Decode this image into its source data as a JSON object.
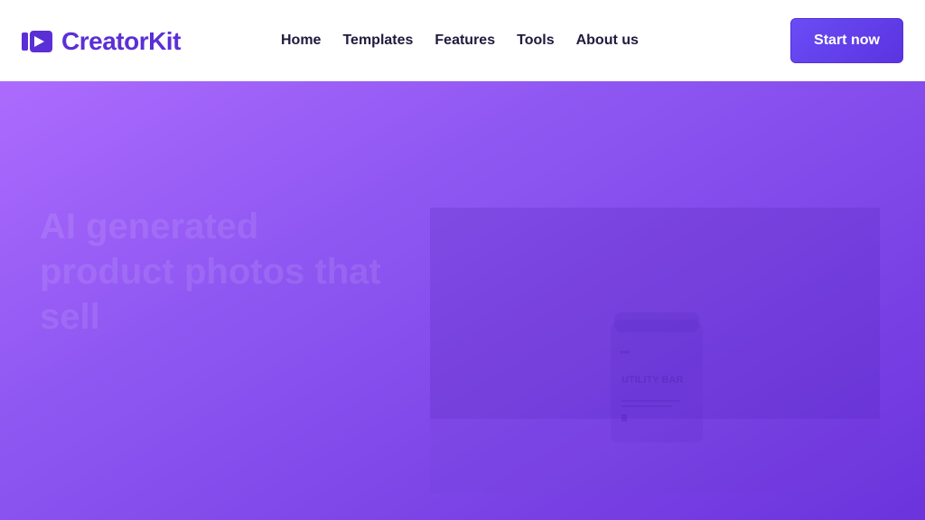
{
  "brand": {
    "name": "CreatorKit",
    "icon": "play-camera-icon",
    "color": "#5b2fd6"
  },
  "nav": {
    "items": [
      {
        "label": "Home"
      },
      {
        "label": "Templates"
      },
      {
        "label": "Features"
      },
      {
        "label": "Tools"
      },
      {
        "label": "About us"
      }
    ]
  },
  "cta": {
    "label": "Start now",
    "color": "#6a4cf5"
  },
  "hero": {
    "headline": "AI generated product photos that sell",
    "background_start": "#ac6bfd",
    "background_end": "#6b33dc"
  },
  "product": {
    "jar_title": "UTILITY BAR"
  }
}
